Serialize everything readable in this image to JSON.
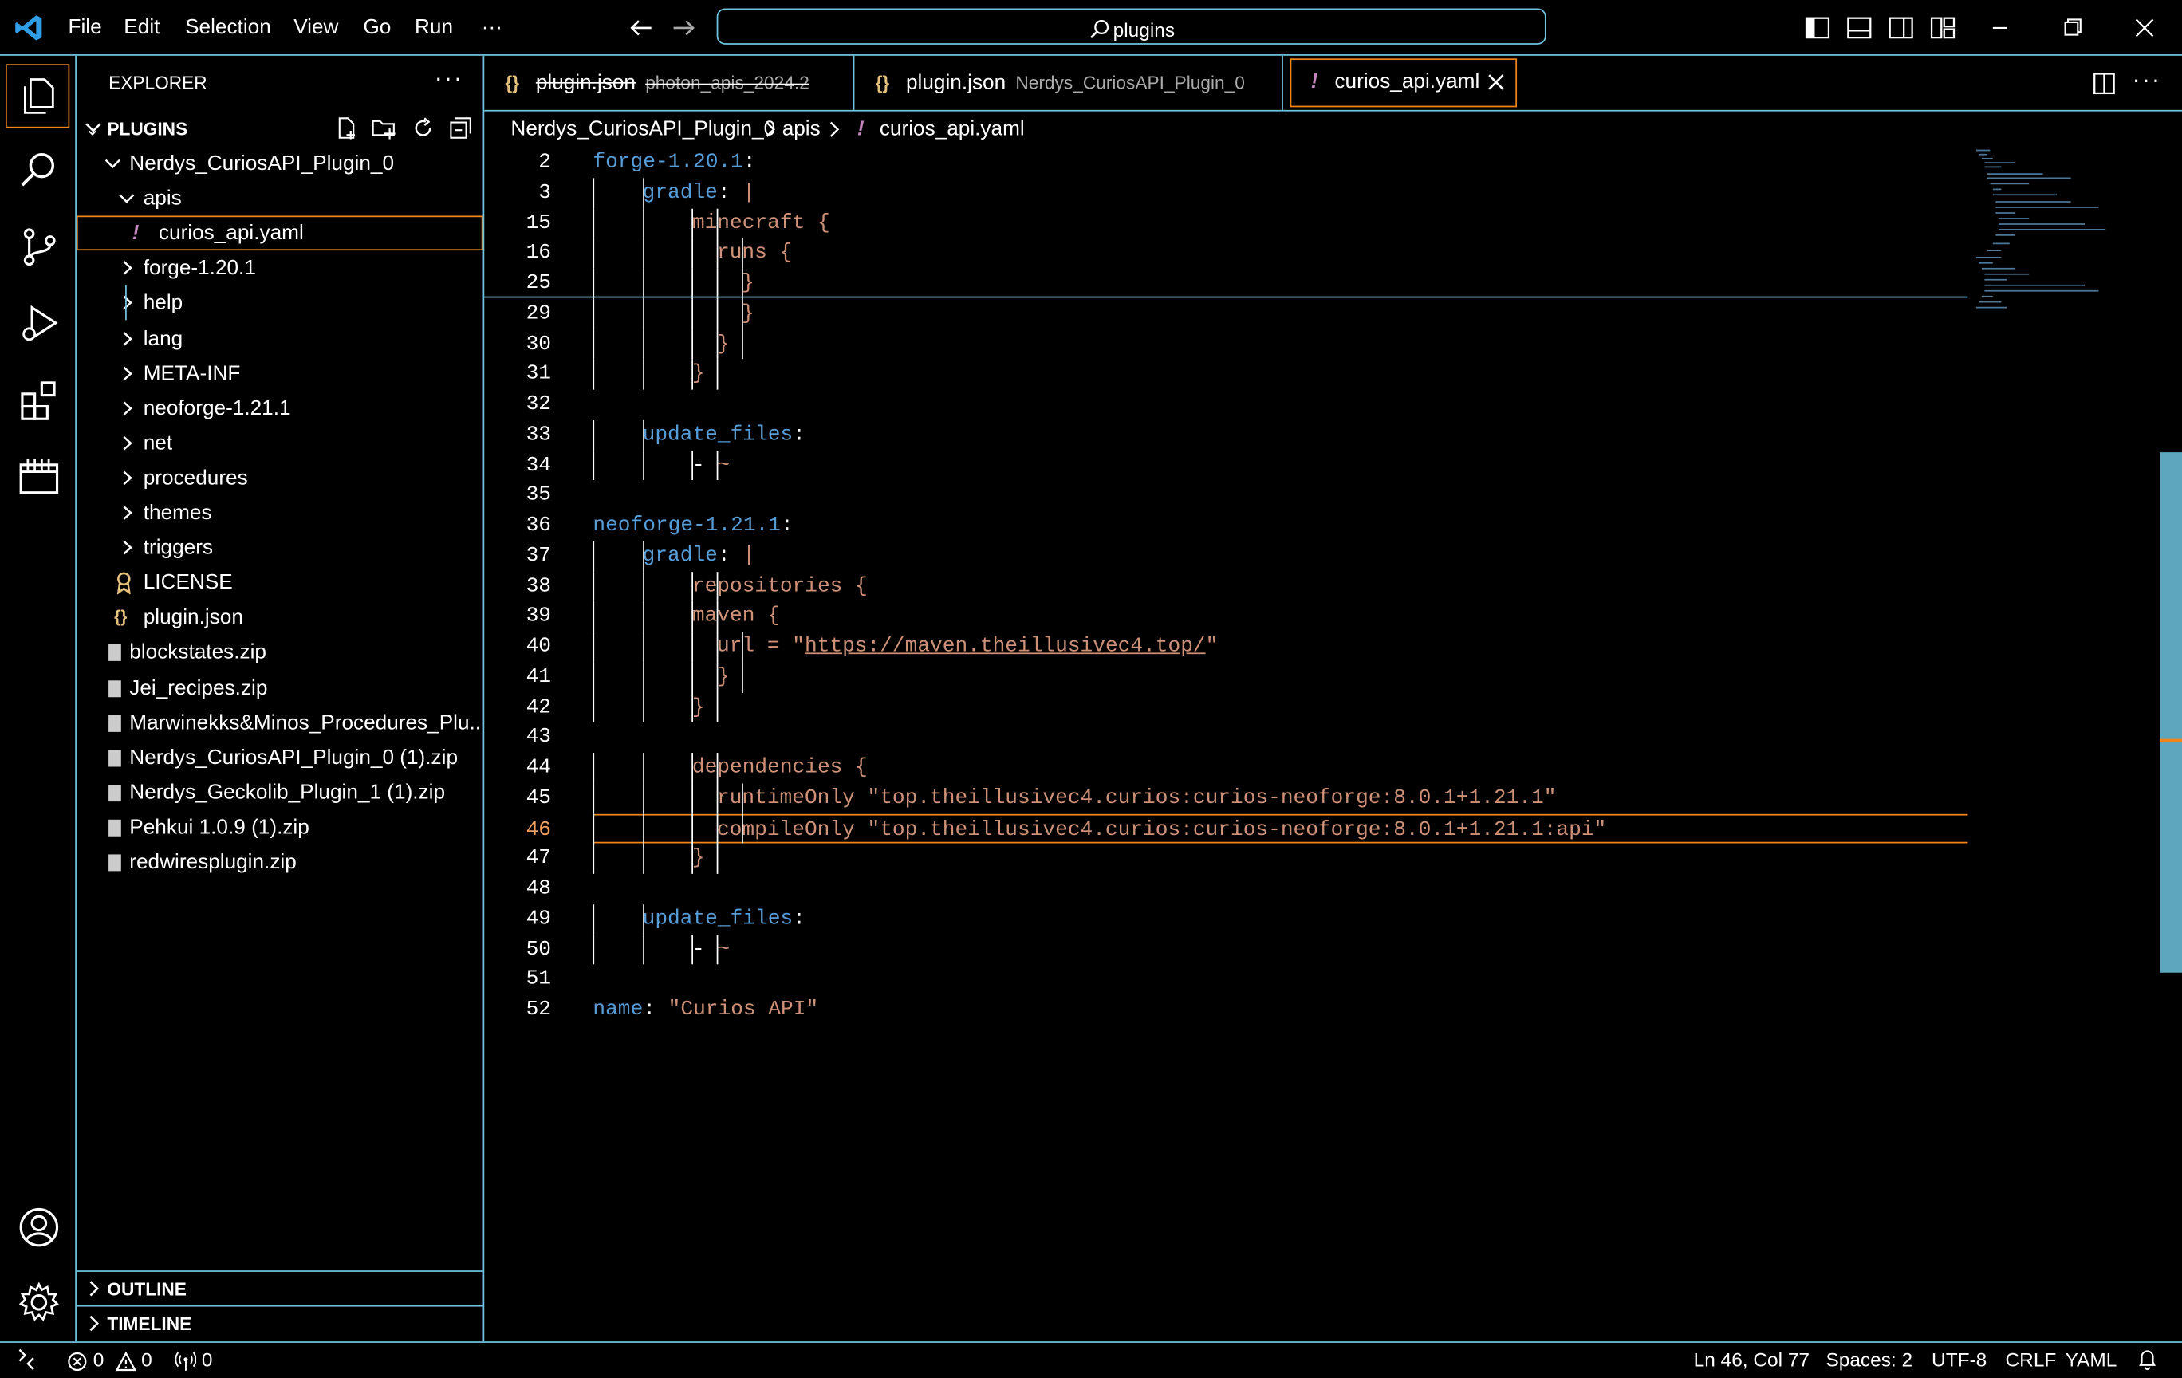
{
  "titlebar": {
    "menu": [
      "File",
      "Edit",
      "Selection",
      "View",
      "Go",
      "Run",
      "···"
    ],
    "search_text": "plugins"
  },
  "sidebar": {
    "title": "EXPLORER",
    "section": "PLUGINS",
    "tree": [
      {
        "label": "Nerdys_CuriosAPI_Plugin_0",
        "depth": 1,
        "kind": "folder-open"
      },
      {
        "label": "apis",
        "depth": 2,
        "kind": "folder-open"
      },
      {
        "label": "curios_api.yaml",
        "depth": 3,
        "kind": "yaml",
        "selected": true
      },
      {
        "label": "forge-1.20.1",
        "depth": 2,
        "kind": "folder"
      },
      {
        "label": "help",
        "depth": 2,
        "kind": "folder"
      },
      {
        "label": "lang",
        "depth": 2,
        "kind": "folder"
      },
      {
        "label": "META-INF",
        "depth": 2,
        "kind": "folder"
      },
      {
        "label": "neoforge-1.21.1",
        "depth": 2,
        "kind": "folder"
      },
      {
        "label": "net",
        "depth": 2,
        "kind": "folder"
      },
      {
        "label": "procedures",
        "depth": 2,
        "kind": "folder"
      },
      {
        "label": "themes",
        "depth": 2,
        "kind": "folder"
      },
      {
        "label": "triggers",
        "depth": 2,
        "kind": "folder"
      },
      {
        "label": "LICENSE",
        "depth": 2,
        "kind": "license"
      },
      {
        "label": "plugin.json",
        "depth": 2,
        "kind": "json"
      },
      {
        "label": "blockstates.zip",
        "depth": 1,
        "kind": "zip"
      },
      {
        "label": "Jei_recipes.zip",
        "depth": 1,
        "kind": "zip"
      },
      {
        "label": "Marwinekks&Minos_Procedures_Plu...",
        "depth": 1,
        "kind": "zip"
      },
      {
        "label": "Nerdys_CuriosAPI_Plugin_0 (1).zip",
        "depth": 1,
        "kind": "zip"
      },
      {
        "label": "Nerdys_Geckolib_Plugin_1 (1).zip",
        "depth": 1,
        "kind": "zip"
      },
      {
        "label": "Pehkui 1.0.9 (1).zip",
        "depth": 1,
        "kind": "zip"
      },
      {
        "label": "redwiresplugin.zip",
        "depth": 1,
        "kind": "zip"
      }
    ],
    "outline": "OUTLINE",
    "timeline": "TIMELINE"
  },
  "tabs": [
    {
      "name": "plugin.json",
      "desc": "photon_apis_2024.2",
      "icon": "{}",
      "strikethrough": true
    },
    {
      "name": "plugin.json",
      "desc": "Nerdys_CuriosAPI_Plugin_0",
      "icon": "{}"
    },
    {
      "name": "curios_api.yaml",
      "desc": "",
      "icon": "!",
      "active": true
    }
  ],
  "breadcrumb": [
    "Nerdys_CuriosAPI_Plugin_0",
    "apis",
    "curios_api.yaml"
  ],
  "editor": {
    "lines": [
      {
        "n": "2",
        "indent": 0,
        "parts": [
          [
            "k",
            "forge-1.20.1"
          ],
          [
            "w",
            ":"
          ]
        ]
      },
      {
        "n": "3",
        "indent": 1,
        "parts": [
          [
            "k",
            "gradle"
          ],
          [
            "w",
            ": "
          ],
          [
            "s",
            "|"
          ]
        ]
      },
      {
        "n": "15",
        "indent": 2,
        "parts": [
          [
            "s",
            "minecraft {"
          ]
        ]
      },
      {
        "n": "16",
        "indent": 2.5,
        "parts": [
          [
            "s",
            "runs {"
          ]
        ]
      },
      {
        "n": "25",
        "indent": 3,
        "parts": [
          [
            "s",
            "}"
          ]
        ]
      },
      {
        "n": "29",
        "indent": 3,
        "parts": [
          [
            "s",
            "}"
          ]
        ]
      },
      {
        "n": "30",
        "indent": 2.5,
        "parts": [
          [
            "s",
            "}"
          ]
        ]
      },
      {
        "n": "31",
        "indent": 2,
        "parts": [
          [
            "s",
            "}"
          ]
        ]
      },
      {
        "n": "32",
        "indent": 0,
        "parts": []
      },
      {
        "n": "33",
        "indent": 1,
        "parts": [
          [
            "k",
            "update_files"
          ],
          [
            "w",
            ":"
          ]
        ]
      },
      {
        "n": "34",
        "indent": 2,
        "parts": [
          [
            "w",
            "- "
          ],
          [
            "s",
            "~"
          ]
        ]
      },
      {
        "n": "35",
        "indent": 0,
        "parts": []
      },
      {
        "n": "36",
        "indent": 0,
        "parts": [
          [
            "k",
            "neoforge-1.21.1"
          ],
          [
            "w",
            ":"
          ]
        ]
      },
      {
        "n": "37",
        "indent": 1,
        "parts": [
          [
            "k",
            "gradle"
          ],
          [
            "w",
            ": "
          ],
          [
            "s",
            "|"
          ]
        ]
      },
      {
        "n": "38",
        "indent": 2,
        "parts": [
          [
            "s",
            "repositories {"
          ]
        ]
      },
      {
        "n": "39",
        "indent": 2,
        "parts": [
          [
            "s",
            "maven {"
          ]
        ]
      },
      {
        "n": "40",
        "indent": 2.5,
        "parts": [
          [
            "s",
            "url = \""
          ],
          [
            "u",
            "https://maven.theillusivec4.top/"
          ],
          [
            "s",
            "\""
          ]
        ]
      },
      {
        "n": "41",
        "indent": 2.5,
        "parts": [
          [
            "s",
            "}"
          ]
        ]
      },
      {
        "n": "42",
        "indent": 2,
        "parts": [
          [
            "s",
            "}"
          ]
        ]
      },
      {
        "n": "43",
        "indent": 0,
        "parts": []
      },
      {
        "n": "44",
        "indent": 2,
        "parts": [
          [
            "s",
            "dependencies {"
          ]
        ]
      },
      {
        "n": "45",
        "indent": 2.5,
        "parts": [
          [
            "s",
            "runtimeOnly \"top.theillusivec4.curios:curios-neoforge:8.0.1+1.21.1\""
          ]
        ]
      },
      {
        "n": "46",
        "indent": 2.5,
        "parts": [
          [
            "s",
            "compileOnly \"top.theillusivec4.curios:curios-neoforge:8.0.1+1.21.1:api\""
          ]
        ],
        "current": true
      },
      {
        "n": "47",
        "indent": 2,
        "parts": [
          [
            "s",
            "}"
          ]
        ]
      },
      {
        "n": "48",
        "indent": 0,
        "parts": []
      },
      {
        "n": "49",
        "indent": 1,
        "parts": [
          [
            "k",
            "update_files"
          ],
          [
            "w",
            ":"
          ]
        ]
      },
      {
        "n": "50",
        "indent": 2,
        "parts": [
          [
            "w",
            "- "
          ],
          [
            "s",
            "~"
          ]
        ]
      },
      {
        "n": "51",
        "indent": 0,
        "parts": []
      },
      {
        "n": "52",
        "indent": 0,
        "parts": [
          [
            "k",
            "name"
          ],
          [
            "w",
            ": "
          ],
          [
            "s",
            "\"Curios API\""
          ]
        ]
      }
    ]
  },
  "status": {
    "errors": "0",
    "warnings": "0",
    "ports": "0",
    "position": "Ln 46, Col 77",
    "spaces": "Spaces: 2",
    "encoding": "UTF-8",
    "eol": "CRLF",
    "language": "YAML"
  },
  "colors": {
    "border": "#6fc3df",
    "key": "#569cd6",
    "string": "#ce9178",
    "selection_outline": "#f38518"
  }
}
